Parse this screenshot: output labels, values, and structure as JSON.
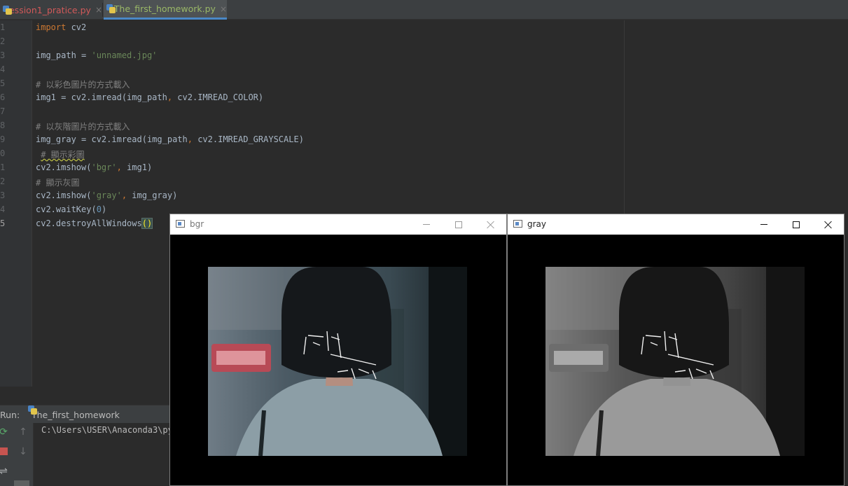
{
  "tabs": [
    {
      "label": "lession1_pratice.py",
      "close": "×",
      "color": "#d15959"
    },
    {
      "label": "The_first_homework.py",
      "close": "×",
      "color": "#9ab867"
    }
  ],
  "editor": {
    "line_numbers": [
      "1",
      "2",
      "3",
      "4",
      "5",
      "6",
      "7",
      "8",
      "9",
      "0",
      "1",
      "2",
      "3",
      "4",
      "5"
    ],
    "code": {
      "l1_kw": "import",
      "l1_rest": " cv2",
      "l3_a": "img_path = ",
      "l3_str": "'unnamed.jpg'",
      "l5": "# 以彩色圖片的方式載入",
      "l6_a": "img1 = cv2.imread(img_path",
      "l6_comma": ",",
      "l6_b": " cv2.IMREAD_COLOR)",
      "l8": "# 以灰階圖片的方式載入",
      "l9_a": "img_gray = cv2.imread(img_path",
      "l9_comma": ",",
      "l9_b": " cv2.IMREAD_GRAYSCALE)",
      "l10_lead": " ",
      "l10": "# 顯示彩圖",
      "l11_a": "cv2.imshow(",
      "l11_str": "'bgr'",
      "l11_comma": ",",
      "l11_b": " img1)",
      "l12": "# 顯示灰圖",
      "l13_a": "cv2.imshow(",
      "l13_str": "'gray'",
      "l13_comma": ",",
      "l13_b": " img_gray)",
      "l14_a": "cv2.waitKey(",
      "l14_num": "0",
      "l14_b": ")",
      "l15_a": "cv2.destroyAllWindows",
      "l15_paren": "()"
    }
  },
  "run_panel": {
    "label": "Run:",
    "tab": "The_first_homework",
    "output": "C:\\Users\\USER\\Anaconda3\\py"
  },
  "windows": [
    {
      "title": "bgr",
      "state": "inactive",
      "image": "color"
    },
    {
      "title": "gray",
      "state": "active",
      "image": "grayscale"
    }
  ],
  "photo_text": {
    "calligraphy_main": "告五人",
    "calligraphy_sub": "迷霧中"
  },
  "icons": [
    "python-file-icon",
    "rerun-icon",
    "stop-icon",
    "scroll-up-icon",
    "scroll-down-icon",
    "soft-wrap-icon",
    "window-app-icon",
    "minimize-icon",
    "maximize-icon",
    "close-icon"
  ]
}
